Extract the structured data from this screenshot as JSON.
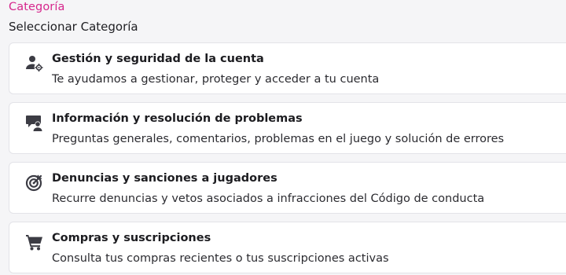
{
  "header": {
    "category_label": "Categoría",
    "select_label": "Seleccionar Categoría"
  },
  "categories": [
    {
      "icon": "account-settings-icon",
      "title": "Gestión y seguridad de la cuenta",
      "description": "Te ayudamos a gestionar, proteger y acceder a tu cuenta"
    },
    {
      "icon": "support-chat-icon",
      "title": "Información y resolución de problemas",
      "description": "Preguntas generales, comentarios, problemas en el juego y solución de errores"
    },
    {
      "icon": "target-icon",
      "title": "Denuncias y sanciones a jugadores",
      "description": "Recurre denuncias y vetos asociados a infracciones del Código de conducta"
    },
    {
      "icon": "shopping-cart-icon",
      "title": "Compras y suscripciones",
      "description": "Consulta tus compras recientes o tus suscripciones activas"
    }
  ],
  "colors": {
    "accent": "#d6268c",
    "icon": "#3c3c44",
    "card_border": "#e3e3e8",
    "background": "#f5f5f7"
  }
}
